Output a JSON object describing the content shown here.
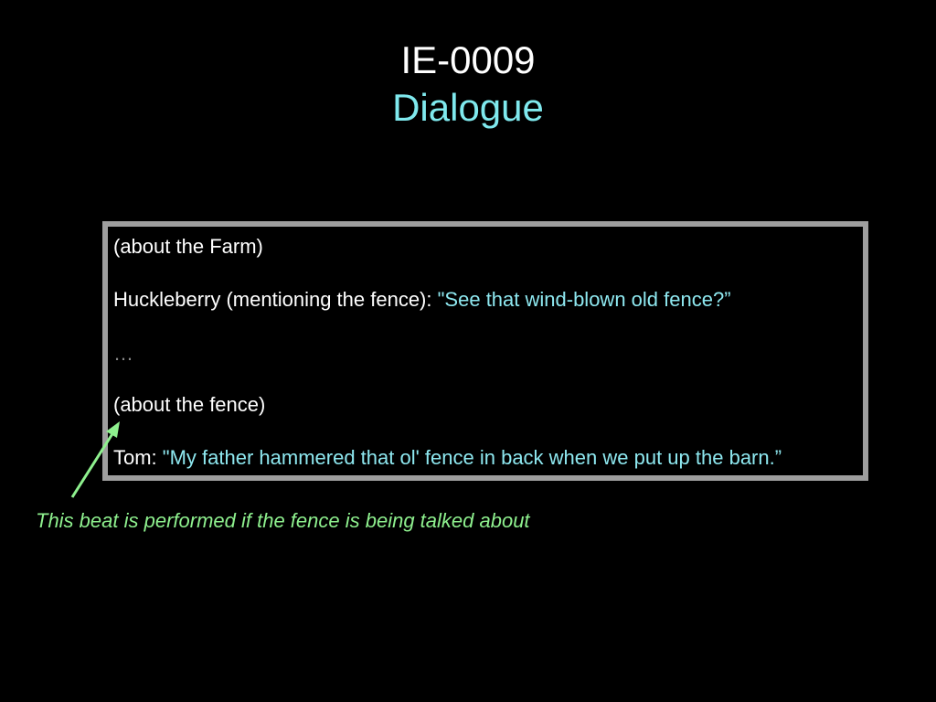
{
  "slide": {
    "title": "IE-0009",
    "subtitle": "Dialogue"
  },
  "dialogue": {
    "line1": "(about the Farm)",
    "line2_speaker": "Huckleberry (mentioning the fence): ",
    "line2_quote": "\"See that wind-blown old fence?”",
    "line3": "…",
    "line4": "(about the fence)",
    "line5_speaker": "Tom: ",
    "line5_quote": "\"My father hammered that ol' fence in back when we put up the barn.”"
  },
  "annotation": {
    "text": "This beat is performed if the fence is being talked about"
  },
  "colors": {
    "background": "#000000",
    "title": "#ffffff",
    "accent_cyan": "#7fe9ee",
    "quote_cyan": "#8ee8f0",
    "annotation_green": "#8ef08e",
    "box_border": "#9e9e9e",
    "ellipsis_gray": "#8a8a8a"
  }
}
